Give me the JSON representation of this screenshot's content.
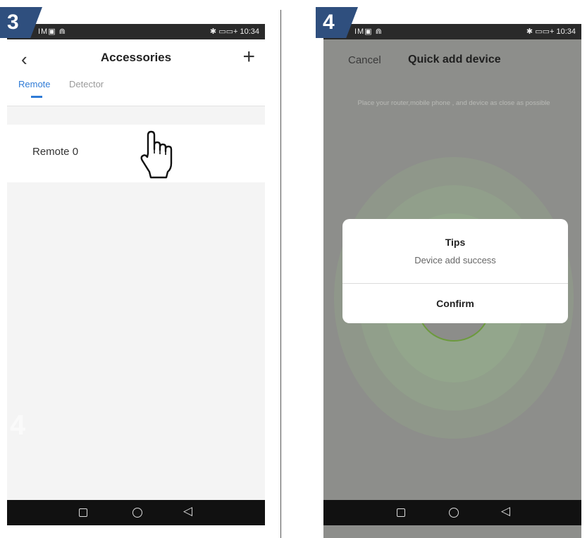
{
  "steps": {
    "left": "3",
    "right": "4"
  },
  "statusbar": {
    "left_icons": "IM▣ ⋒",
    "right": "✱ ▭▭+ 10:34"
  },
  "accessories": {
    "title": "Accessories",
    "back_icon": "chevron-left-icon",
    "add_icon": "plus-icon",
    "tabs": [
      {
        "label": "Remote",
        "active": true
      },
      {
        "label": "Detector",
        "active": false
      }
    ],
    "items": [
      {
        "label": "Remote 0"
      }
    ],
    "ghost_number": "4",
    "accent": "#2f7bd6"
  },
  "quick_add": {
    "cancel_label": "Cancel",
    "title": "Quick add device",
    "hint": "Place your router,mobile phone , and device as close as possible",
    "dialog": {
      "title": "Tips",
      "message": "Device add success",
      "confirm_label": "Confirm"
    }
  },
  "navbar": {
    "square_icon": "recents-icon",
    "circle_icon": "home-icon",
    "back_icon": "back-triangle-icon"
  }
}
